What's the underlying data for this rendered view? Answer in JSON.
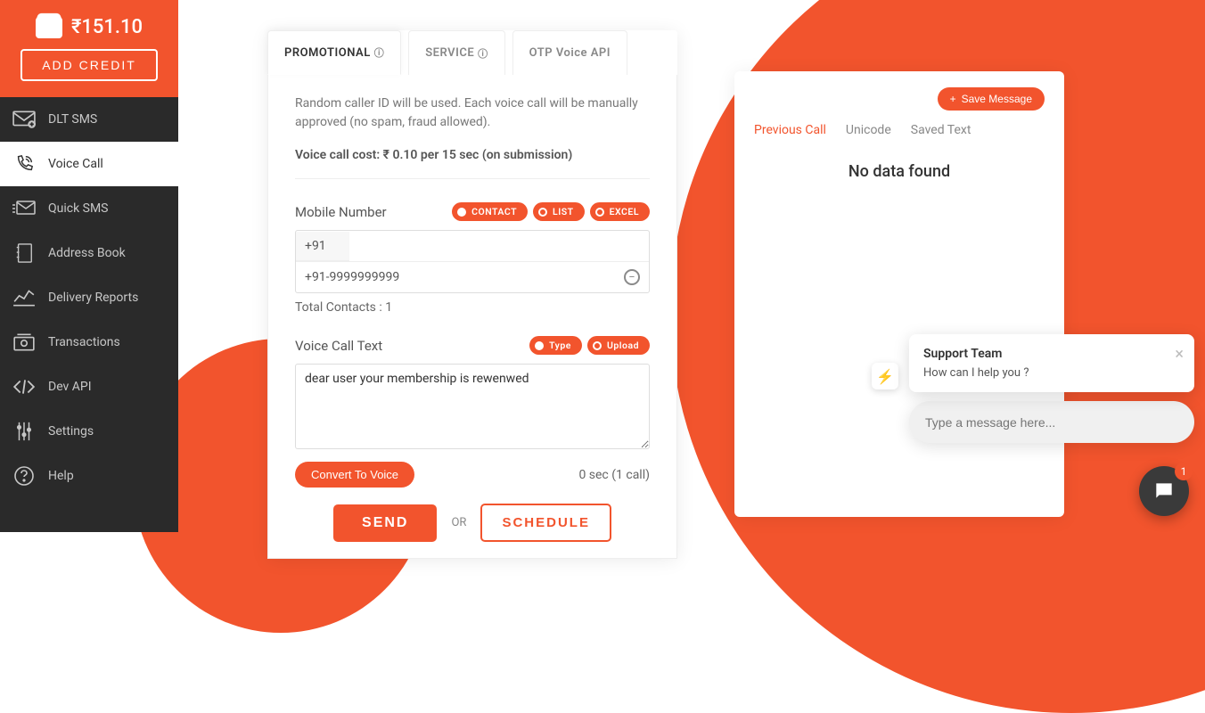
{
  "wallet": {
    "balance": "₹151.10",
    "add_credit_label": "ADD CREDIT"
  },
  "nav": {
    "items": [
      {
        "label": "DLT SMS",
        "active": false
      },
      {
        "label": "Voice Call",
        "active": true
      },
      {
        "label": "Quick SMS",
        "active": false
      },
      {
        "label": "Address Book",
        "active": false
      },
      {
        "label": "Delivery Reports",
        "active": false
      },
      {
        "label": "Transactions",
        "active": false
      },
      {
        "label": "Dev API",
        "active": false
      },
      {
        "label": "Settings",
        "active": false
      },
      {
        "label": "Help",
        "active": false
      }
    ]
  },
  "tabs": {
    "promotional": "PROMOTIONAL",
    "service": "SERVICE",
    "otp": "OTP Voice API"
  },
  "main": {
    "info": "Random caller ID will be used. Each voice call will be manually approved (no spam, fraud allowed).",
    "cost": "Voice call cost: ₹ 0.10 per 15 sec (on submission)",
    "mobile_label": "Mobile Number",
    "pills": {
      "contact": "CONTACT",
      "list": "LIST",
      "excel": "EXCEL"
    },
    "prefix": "+91",
    "phone_entry_value": "",
    "contact": "+91-9999999999",
    "total_contacts": "Total Contacts : 1",
    "voice_label": "Voice Call Text",
    "voice_pills": {
      "type": "Type",
      "upload": "Upload"
    },
    "voice_text": "dear user your membership is rewenwed",
    "convert_label": "Convert To Voice",
    "call_count": "0 sec (1 call)",
    "send_label": "SEND",
    "or_label": "OR",
    "schedule_label": "SCHEDULE"
  },
  "right": {
    "save_label": "Save Message",
    "tabs": {
      "previous": "Previous Call",
      "unicode": "Unicode",
      "saved": "Saved Text"
    },
    "nodata": "No data found"
  },
  "chat": {
    "title": "Support Team",
    "text": "How can I help you ?",
    "placeholder": "Type a message here...",
    "badge": "1",
    "avatar_symbol": "⚡"
  }
}
